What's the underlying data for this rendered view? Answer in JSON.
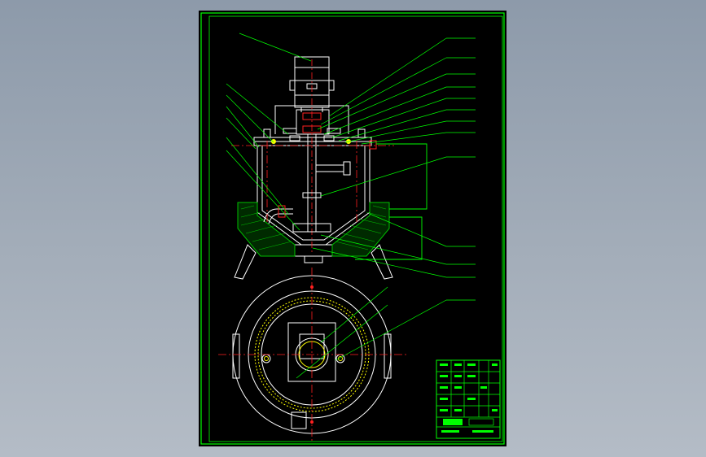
{
  "viewer": {
    "background": "#9aa6b4"
  },
  "drawing": {
    "sheet_color": "#000000",
    "line_colors": {
      "outline": "#ffffff",
      "border": "#00ff00",
      "leader": "#00ff00",
      "centerline": "#ff2020",
      "hatch": "#00c000",
      "accent": "#ffff00"
    },
    "part_labels_left": [
      "",
      "",
      "",
      "",
      "",
      ""
    ],
    "part_labels_right": [
      "",
      "",
      "",
      "",
      "",
      "",
      "",
      "",
      "",
      "",
      "",
      "",
      ""
    ],
    "title_block": {
      "title": "",
      "rows": [
        "",
        "",
        "",
        "",
        "",
        ""
      ]
    }
  }
}
